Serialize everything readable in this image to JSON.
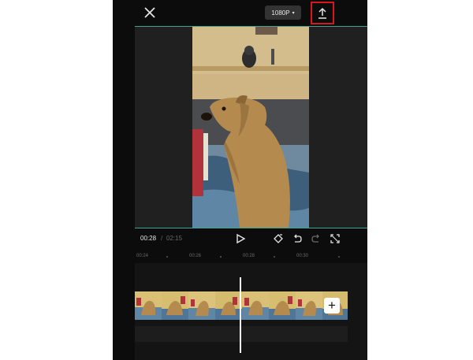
{
  "topbar": {
    "resolution_label": "1080P",
    "resolution_caret": "▾"
  },
  "playback": {
    "current_time": "00:28",
    "separator": "/",
    "total_time": "02:15"
  },
  "timeline": {
    "ticks": [
      "00:24",
      "00:26",
      "00:28",
      "00:30"
    ]
  },
  "track": {
    "add_label": "+"
  },
  "colors": {
    "accent_line": "#3fa58f",
    "highlight_box": "#d8181e"
  },
  "icons": [
    "close-icon",
    "export-icon",
    "play-icon",
    "keyframe-icon",
    "undo-icon",
    "redo-icon",
    "fullscreen-icon",
    "add-icon"
  ]
}
